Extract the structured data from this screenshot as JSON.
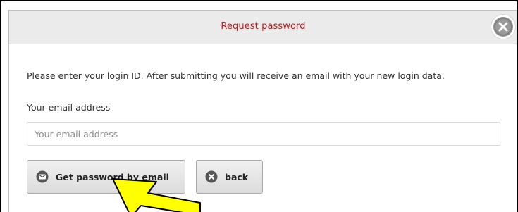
{
  "dialog": {
    "title": "Request password",
    "close_icon": "close-circle-icon",
    "intro_text": "Please enter your login ID. After submitting you will receive an email with your new login data.",
    "email_label": "Your email address",
    "email_placeholder": "Your email address",
    "email_value": ""
  },
  "buttons": {
    "get_password_label": "Get password by email",
    "get_password_icon": "envelope-icon",
    "back_label": "back",
    "back_icon": "close-circle-icon"
  },
  "colors": {
    "title": "#c41b1b",
    "titlebar_bg": "#ebebeb",
    "button_bg": "#e6e6e6",
    "cursor": "#ffff00"
  }
}
